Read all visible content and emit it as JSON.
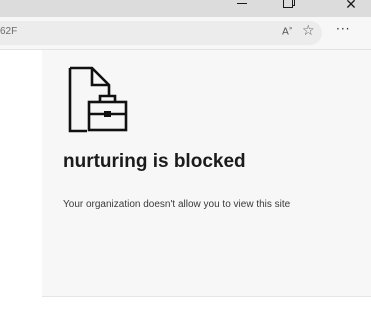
{
  "window": {
    "minimize_glyph": "",
    "close_glyph": "✕"
  },
  "toolbar": {
    "url_fragment": "62F",
    "read_aloud_label": "A",
    "read_aloud_sup": "",
    "favorite_glyph": "☆",
    "more_glyph": "···"
  },
  "page": {
    "title": "nurturing is blocked",
    "message": "Your organization doesn't allow you to view this site"
  },
  "icons": {
    "window_minimize": "minimize-icon",
    "window_maximize": "maximize-icon",
    "window_close": "close-icon",
    "read_aloud": "read-aloud-icon",
    "favorite": "star-icon",
    "more": "more-options-icon",
    "blocked": "blocked-document-briefcase-icon"
  }
}
